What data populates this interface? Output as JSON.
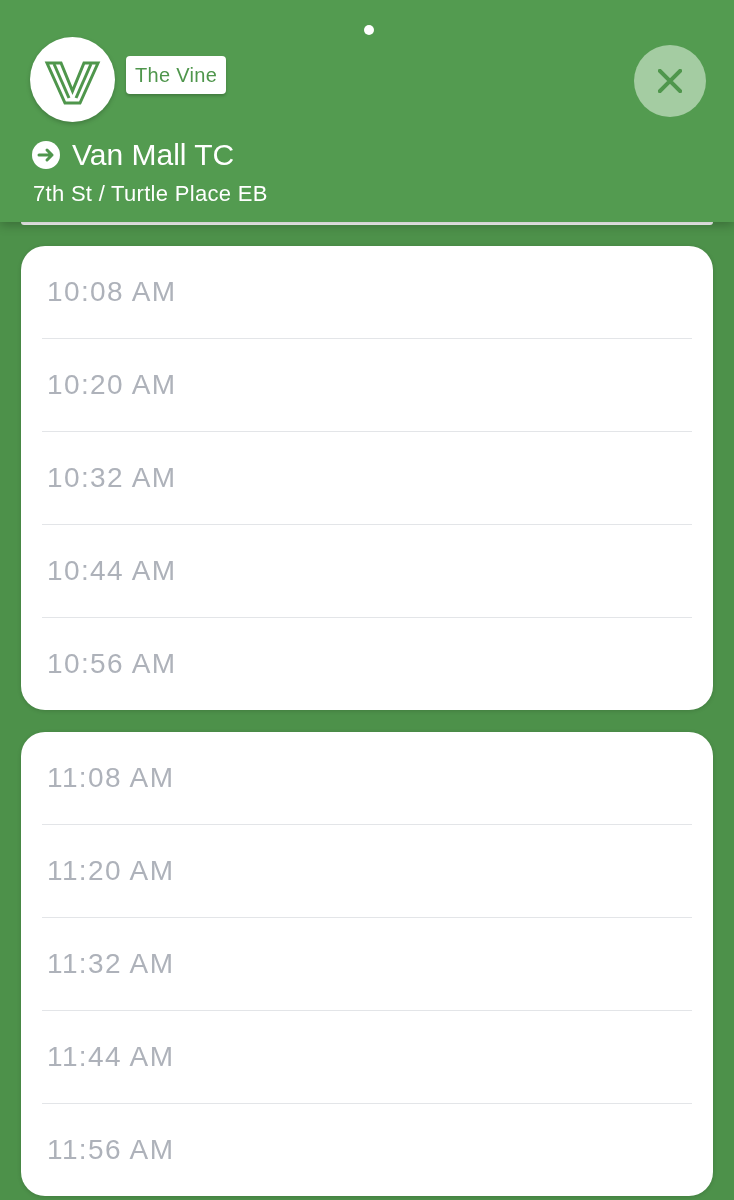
{
  "header": {
    "agency_badge": "The Vine",
    "destination": "Van Mall TC",
    "stop": "7th St / Turtle Place EB"
  },
  "schedule_groups": [
    {
      "times": [
        "10:08 AM",
        "10:20 AM",
        "10:32 AM",
        "10:44 AM",
        "10:56 AM"
      ]
    },
    {
      "times": [
        "11:08 AM",
        "11:20 AM",
        "11:32 AM",
        "11:44 AM",
        "11:56 AM"
      ]
    }
  ]
}
